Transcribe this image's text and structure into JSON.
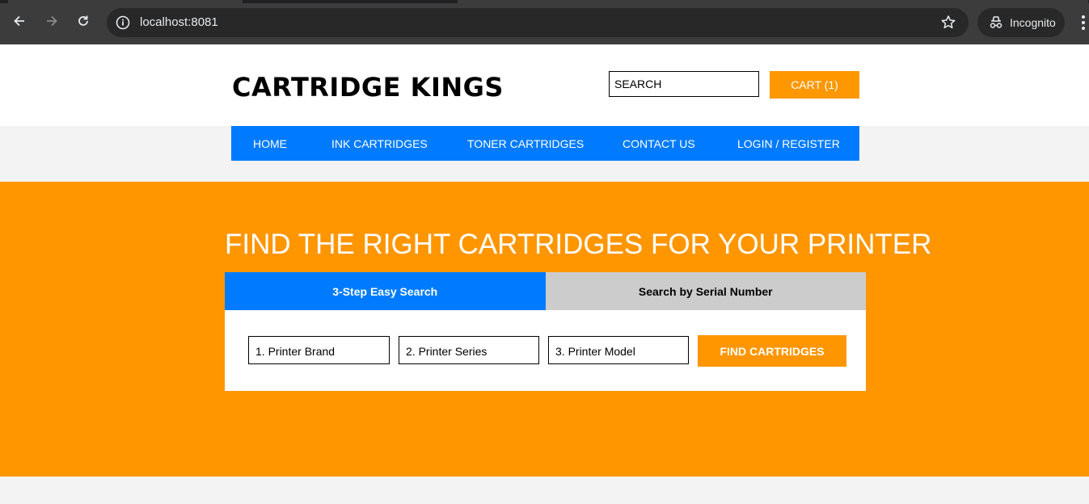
{
  "browser": {
    "url": "localhost:8081",
    "profile_label": "Incognito"
  },
  "header": {
    "logo": "CARTRIDGE KINGS",
    "search_placeholder": "SEARCH",
    "cart_label": "CART (1)"
  },
  "nav": {
    "items": [
      "HOME",
      "INK CARTRIDGES",
      "TONER CARTRIDGES",
      "CONTACT US",
      "LOGIN / REGISTER"
    ]
  },
  "hero": {
    "title": "FIND THE RIGHT CARTRIDGES FOR YOUR PRINTER",
    "tabs": [
      {
        "label": "3-Step Easy Search",
        "active": true
      },
      {
        "label": "Search by Serial Number",
        "active": false
      }
    ],
    "selects": [
      "1. Printer Brand",
      "2. Printer Series",
      "3. Printer Model"
    ],
    "find_button": "FIND CARTRIDGES"
  },
  "colors": {
    "accent_orange": "#ff9600",
    "nav_blue": "#007bff",
    "inactive_tab": "#cccccc"
  }
}
